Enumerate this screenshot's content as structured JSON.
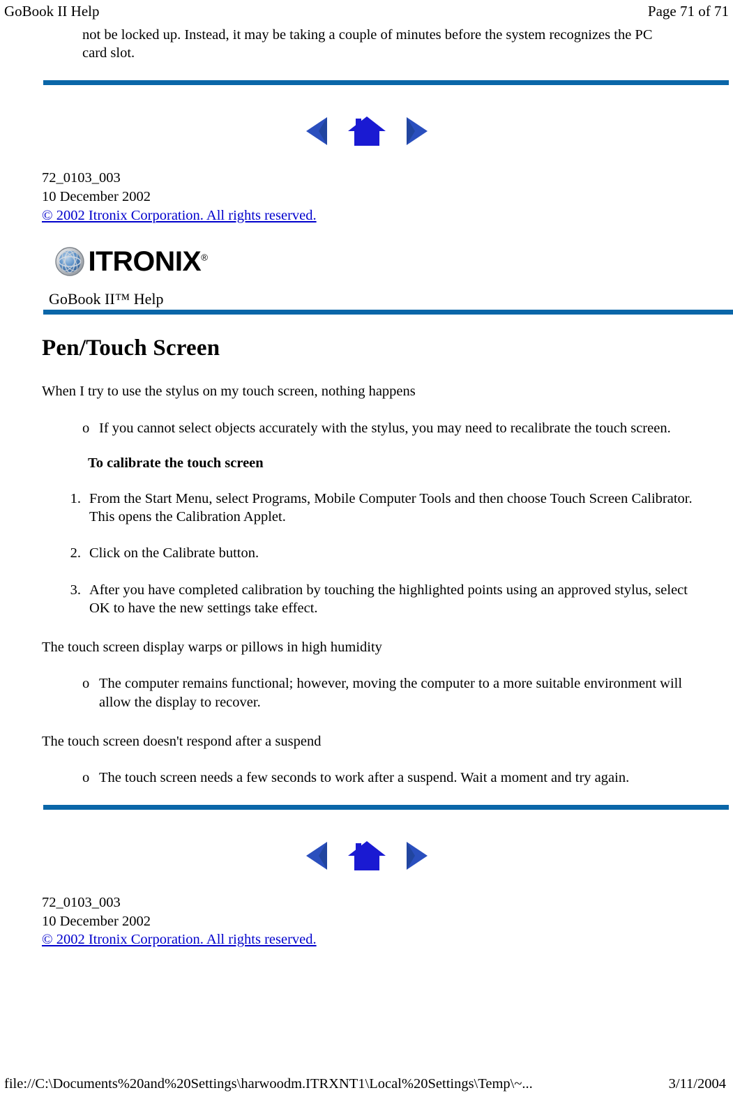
{
  "header": {
    "doc_title": "GoBook II Help",
    "page_indicator": "Page 71 of 71"
  },
  "top_paragraph": "not be locked up.  Instead, it may be taking a couple of minutes before the system recognizes the PC card slot.",
  "nav": {
    "prev_label": "previous-page",
    "home_label": "home",
    "next_label": "next-page",
    "arrow_color": "#2a4fbe",
    "house_color": "#1a1ad2"
  },
  "doc_info": {
    "doc_number": "72_0103_003",
    "doc_date": "10 December 2002",
    "copyright": "© 2002 Itronix Corporation.  All rights reserved.",
    "link_color": "#0000cc"
  },
  "logo": {
    "wordmark": "ITRONIX",
    "registered": "®",
    "globe_blue": "#4a7fc1",
    "globe_silver": "#c9cdd2"
  },
  "product_title": "GoBook II™ Help",
  "rule_color": "#0a66a8",
  "main_heading": "Pen/Touch Screen",
  "sections": [
    {
      "question": "When I try to use the stylus on my touch screen, nothing happens",
      "bullets": [
        "If you cannot select objects accurately with the stylus, you may need to recalibrate the touch screen."
      ],
      "sub_heading": "To calibrate the touch screen",
      "steps": [
        "From the Start Menu, select Programs, Mobile Computer Tools and then choose Touch Screen Calibrator.  This opens the Calibration Applet.",
        "Click on the Calibrate button.",
        "After you have completed calibration by touching the highlighted points using an approved stylus, select OK to have the new settings take effect."
      ]
    },
    {
      "question": "The touch screen display warps or pillows in high humidity",
      "bullets": [
        "The computer remains functional; however, moving the computer to a more suitable environment will allow the display to recover."
      ]
    },
    {
      "question": "The touch screen doesn't respond after a suspend",
      "bullets": [
        "The touch screen needs a few seconds to work after a suspend.  Wait a moment and try again."
      ]
    }
  ],
  "footer": {
    "file_path": "file://C:\\Documents%20and%20Settings\\harwoodm.ITRXNT1\\Local%20Settings\\Temp\\~...",
    "print_date": "3/11/2004"
  }
}
